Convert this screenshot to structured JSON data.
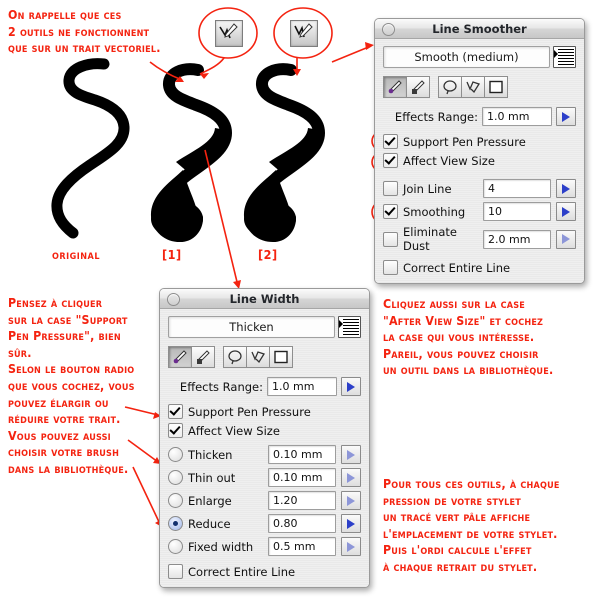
{
  "annotations": {
    "top_left": "On rappelle que ces\n2 outils ne fonctionnent\nque sur un trait vectoriel.",
    "left_mid": "Pensez à cliquer\nsur la case \"Support\nPen Pressure\", bien\nsûr.\nSelon le bouton radio\nque vous cochez, vous\npouvez élargir ou\nréduire votre trait.\nVous pouvez aussi\nchoisir votre brush\ndans la bibliothèque.",
    "right_mid": "Cliquez aussi sur la case\n\"After View Size\" et cochez\nla case qui vous intéresse.\nPareil, vous pouvez choisir\nun outil dans la bibliothèque.",
    "right_bottom": "Pour tous ces outils, à chaque\npression de votre stylet\nun tracé vert pâle affiche\nl'emplacement de votre stylet.\nPuis l'ordi calcule l'effet\nà chaque retrait du stylet."
  },
  "stroke_labels": {
    "original": "Original",
    "one": "[1]",
    "two": "[2]"
  },
  "line_smoother": {
    "title": "Line Smoother",
    "preset": "Smooth (medium)",
    "tools": [
      "pen-dot-tool",
      "pen-square-tool",
      "lasso-tool",
      "polyline-lasso-tool",
      "rectangle-marquee-tool"
    ],
    "effects_range_label": "Effects Range:",
    "effects_range_value": "1.0 mm",
    "support_pen_pressure": {
      "label": "Support Pen Pressure",
      "checked": true
    },
    "affect_view_size": {
      "label": "Affect View Size",
      "checked": true
    },
    "options": [
      {
        "label": "Join Line",
        "checked": false,
        "value": "4",
        "arrow_enabled": true
      },
      {
        "label": "Smoothing",
        "checked": true,
        "value": "10",
        "arrow_enabled": true
      },
      {
        "label": "Eliminate Dust",
        "checked": false,
        "value": "2.0 mm",
        "arrow_enabled": false
      }
    ],
    "correct_entire_line": {
      "label": "Correct Entire Line",
      "checked": false
    }
  },
  "line_width": {
    "title": "Line Width",
    "preset": "Thicken",
    "tools": [
      "pen-dot-tool",
      "pen-square-tool",
      "lasso-tool",
      "polyline-lasso-tool",
      "rectangle-marquee-tool"
    ],
    "effects_range_label": "Effects Range:",
    "effects_range_value": "1.0 mm",
    "support_pen_pressure": {
      "label": "Support Pen Pressure",
      "checked": true
    },
    "affect_view_size": {
      "label": "Affect View Size",
      "checked": true
    },
    "radios": [
      {
        "label": "Thicken",
        "selected": false,
        "value": "0.10 mm",
        "arrow_enabled": false
      },
      {
        "label": "Thin out",
        "selected": false,
        "value": "0.10 mm",
        "arrow_enabled": false
      },
      {
        "label": "Enlarge",
        "selected": false,
        "value": "1.20",
        "arrow_enabled": false
      },
      {
        "label": "Reduce",
        "selected": true,
        "value": "0.80",
        "arrow_enabled": true
      },
      {
        "label": "Fixed width",
        "selected": false,
        "value": "0.5 mm",
        "arrow_enabled": false
      }
    ],
    "correct_entire_line": {
      "label": "Correct Entire Line",
      "checked": false
    }
  },
  "colors": {
    "annotation_red": "#f42310",
    "panel_face": "#ededed",
    "arrow_blue": "#2c3fc9",
    "stroke_black": "#000000"
  }
}
